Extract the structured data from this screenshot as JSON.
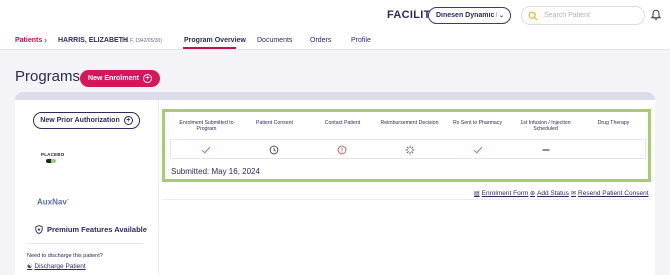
{
  "header": {
    "facility_label": "FACILITY",
    "facility_value": "Dinesen Dynamic H...",
    "search_placeholder": "Search Patient"
  },
  "breadcrumb": {
    "root": "Patients",
    "patient_name": "HARRIS, ELIZABETH",
    "patient_meta": "(81, F, 1942/05/30)"
  },
  "tabs": [
    {
      "label": "Program Overview",
      "active": true
    },
    {
      "label": "Documents",
      "active": false
    },
    {
      "label": "Orders",
      "active": false
    },
    {
      "label": "Profile",
      "active": false
    }
  ],
  "page": {
    "title": "Programs",
    "new_enrolment_label": "New Enrolment"
  },
  "left_panel": {
    "prior_auth_label": "New Prior Authorization",
    "placebo_logo_text": "PLACEBO",
    "auxnav_logo_text": "AuxNav",
    "premium_label": "Premium Features Available",
    "discharge_question": "Need to discharge this patient?",
    "discharge_link": "Discharge Patient"
  },
  "progress": {
    "steps": [
      {
        "label": "Enrolment Submitted to Program",
        "status": "complete",
        "icon": "check-icon"
      },
      {
        "label": "Patient Consent",
        "status": "pending",
        "icon": "clock-icon"
      },
      {
        "label": "Contact Patient",
        "status": "alert",
        "icon": "alert-icon"
      },
      {
        "label": "Reimbursement Decision",
        "status": "in-progress",
        "icon": "spinner-icon"
      },
      {
        "label": "Rx Sent to Pharmacy",
        "status": "complete",
        "icon": "check-icon"
      },
      {
        "label": "1st Infusion / Injection Scheduled",
        "status": "not-applicable",
        "icon": "dash-icon"
      },
      {
        "label": "Drug Therapy",
        "status": "none",
        "icon": ""
      }
    ],
    "submitted_text": "Submitted: May 16, 2024"
  },
  "actions": {
    "enrolment_form": "Enrolment Form",
    "add_status": "Add Status",
    "resend_consent": "Resend Patient Consent"
  },
  "colors": {
    "brand": "#d7155a",
    "navy": "#2d2a5c",
    "progress_border": "#a9c978",
    "check": "#5cb85c",
    "alert": "#d9534f"
  }
}
